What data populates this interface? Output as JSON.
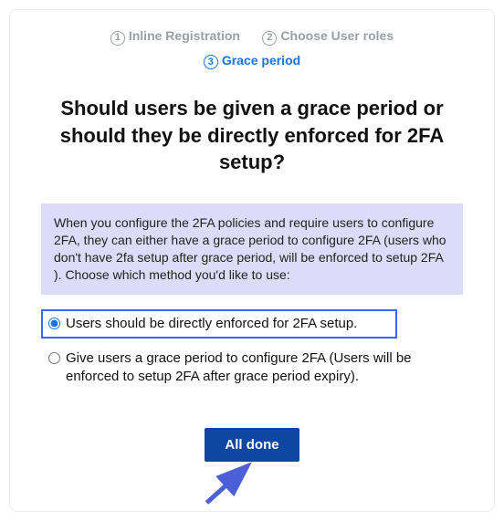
{
  "steps": {
    "step1": {
      "num": "1",
      "label": "Inline Registration"
    },
    "step2": {
      "num": "2",
      "label": "Choose User roles"
    },
    "step3": {
      "num": "3",
      "label": "Grace period"
    }
  },
  "heading": "Should users be given a grace period or should they be directly enforced for 2FA setup?",
  "info": "When you configure the 2FA policies and require users to configure 2FA, they can either have a grace period to configure 2FA (users who don't have 2fa setup after grace period, will be enforced to setup 2FA ). Choose which method you'd like to use:",
  "options": {
    "direct": "Users should be directly enforced for 2FA setup.",
    "grace": "Give users a grace period to configure 2FA (Users will be enforced to setup 2FA after grace period expiry)."
  },
  "button": "All done"
}
